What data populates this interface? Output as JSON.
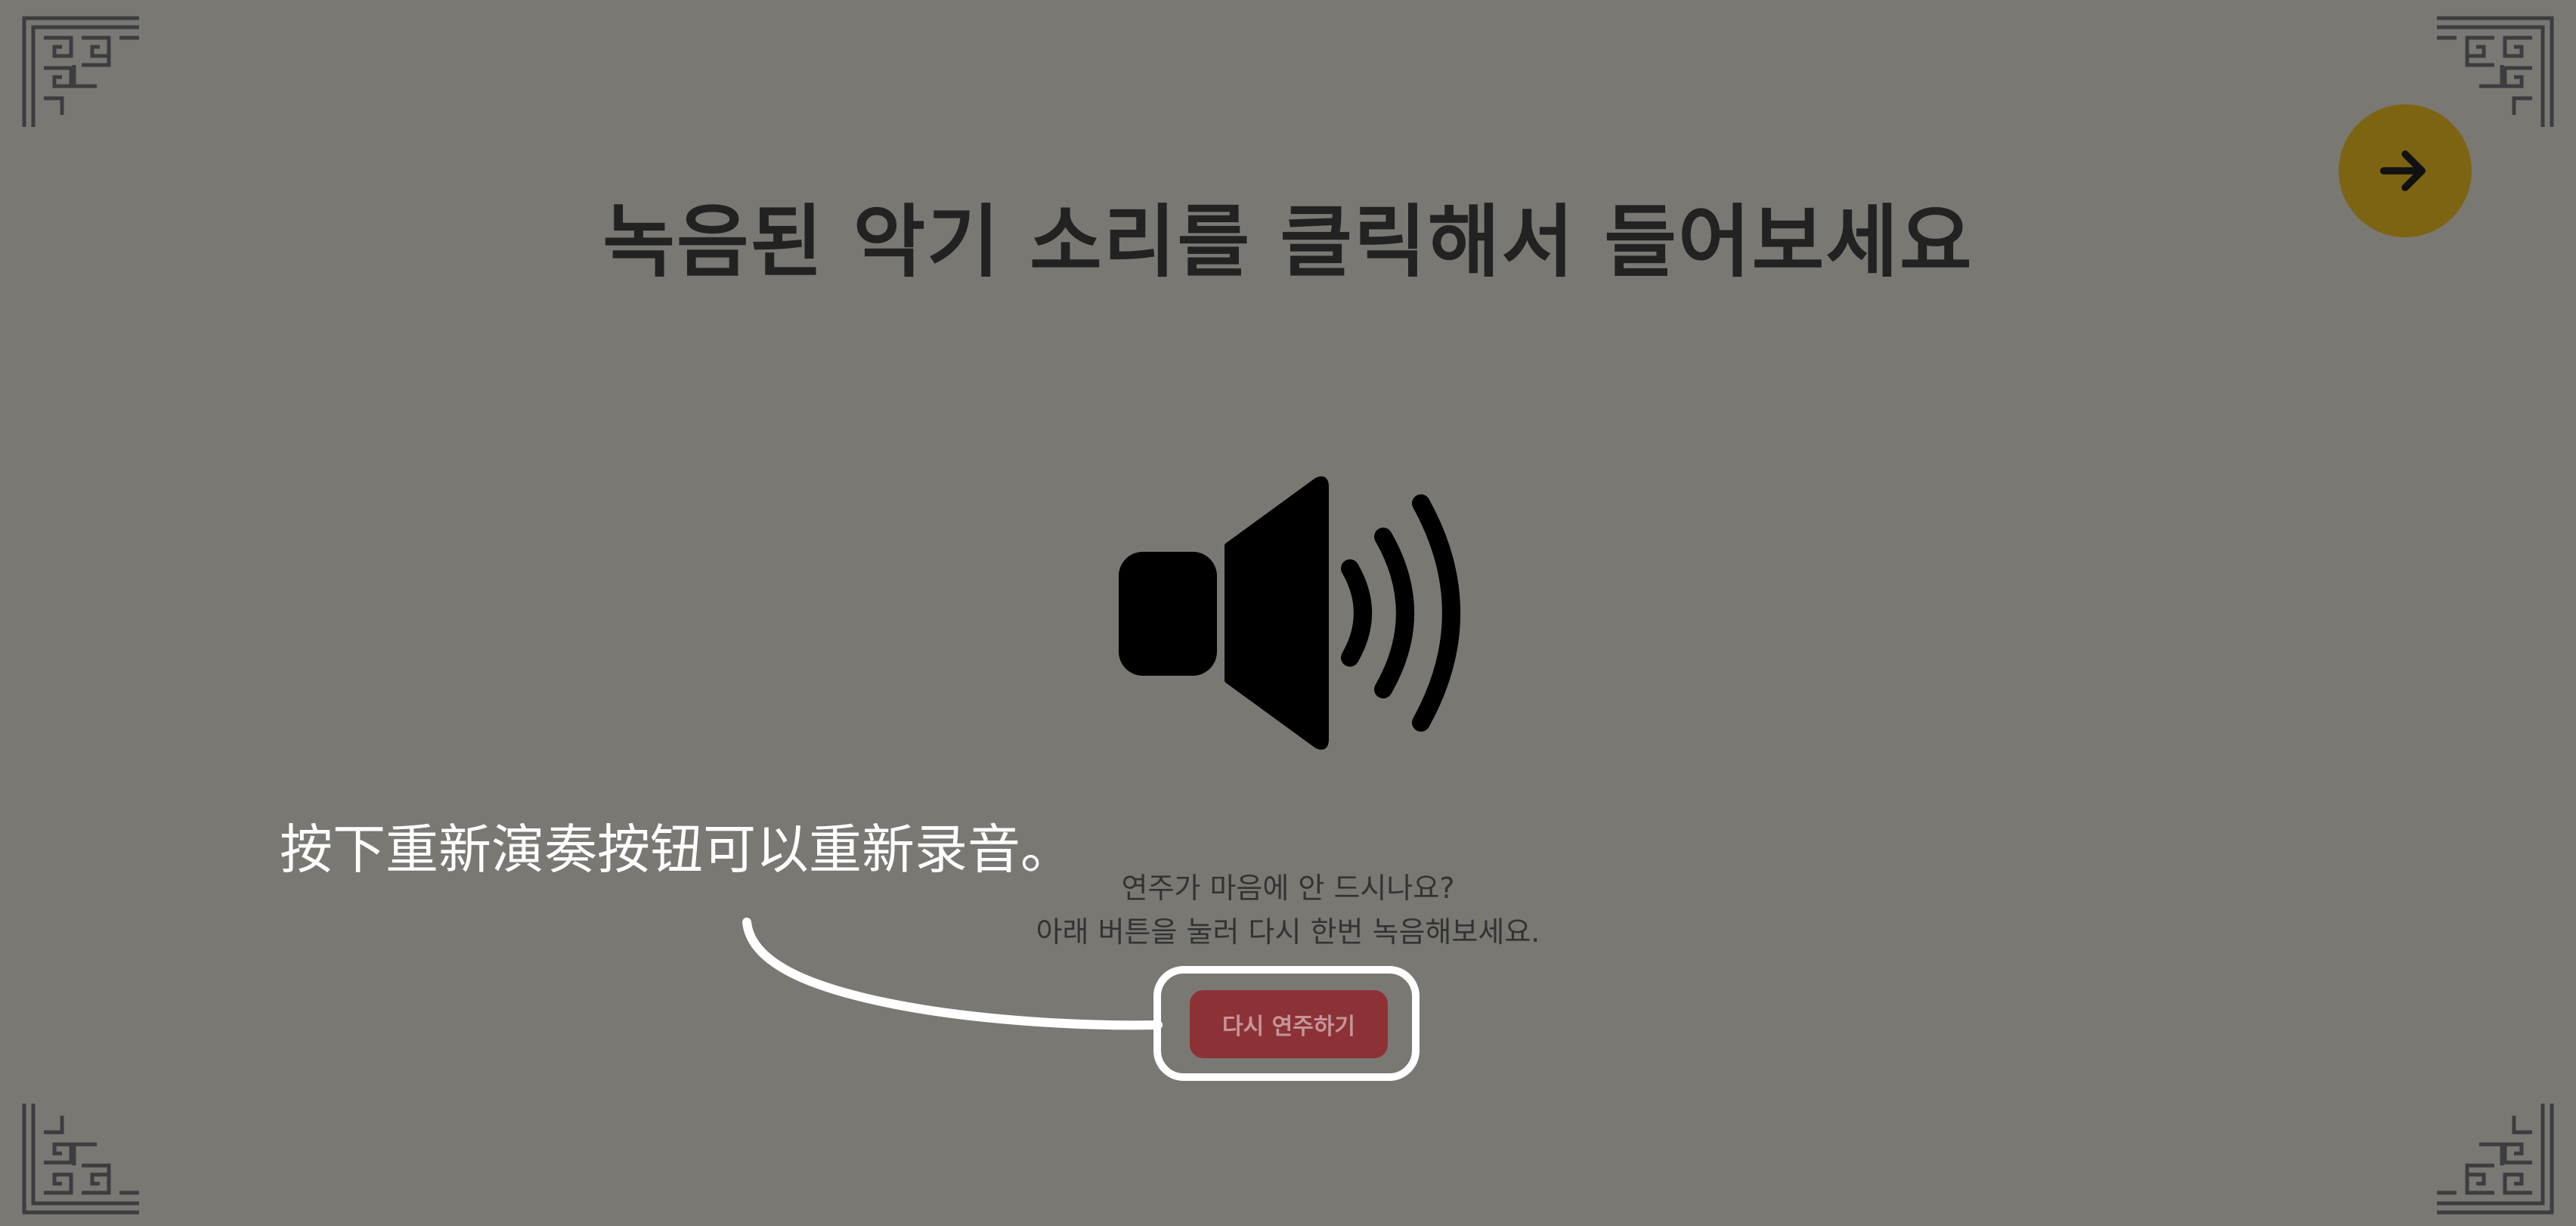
{
  "page": {
    "title": "녹음된 악기 소리를 클릭해서 들어보세요"
  },
  "retry": {
    "line1": "연주가 마음에 안 드시나요?",
    "line2": "아래 버튼을 눌러 다시 한번 녹음해보세요.",
    "button_label": "다시 연주하기"
  },
  "annotation": {
    "text": "按下重新演奏按钮可以重新录音。"
  },
  "icons": {
    "next": "arrow-right-icon",
    "audio": "speaker-volume-icon",
    "corners": "korean-lattice-corner-ornament"
  },
  "colors": {
    "background": "#7a7873",
    "next_button": "#7d6413",
    "replay_button": "#8c3236",
    "replay_button_text": "#c49599",
    "title_text": "#222222",
    "annotation": "#ffffff"
  }
}
